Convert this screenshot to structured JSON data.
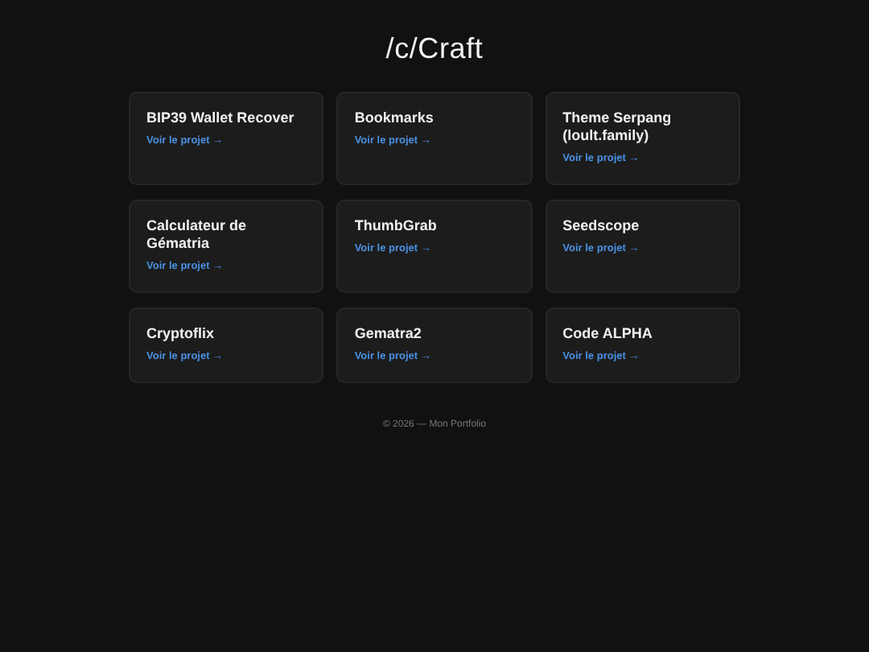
{
  "title": "/c/Craft",
  "projects": [
    {
      "name": "BIP39 Wallet Recover",
      "link": "Voir le projet →"
    },
    {
      "name": "Bookmarks",
      "link": "Voir le projet →"
    },
    {
      "name": "Theme Serpang (loult.family)",
      "link": "Voir le projet →"
    },
    {
      "name": "Calculateur de Gématria",
      "link": "Voir le projet →"
    },
    {
      "name": "ThumbGrab",
      "link": "Voir le projet →"
    },
    {
      "name": "Seedscope",
      "link": "Voir le projet →"
    },
    {
      "name": "Cryptoflix",
      "link": "Voir le projet →"
    },
    {
      "name": "Gematra2",
      "link": "Voir le projet →"
    },
    {
      "name": "Code ALPHA",
      "link": "Voir le projet →"
    }
  ],
  "footer": "© 2026 — Mon Portfolio"
}
